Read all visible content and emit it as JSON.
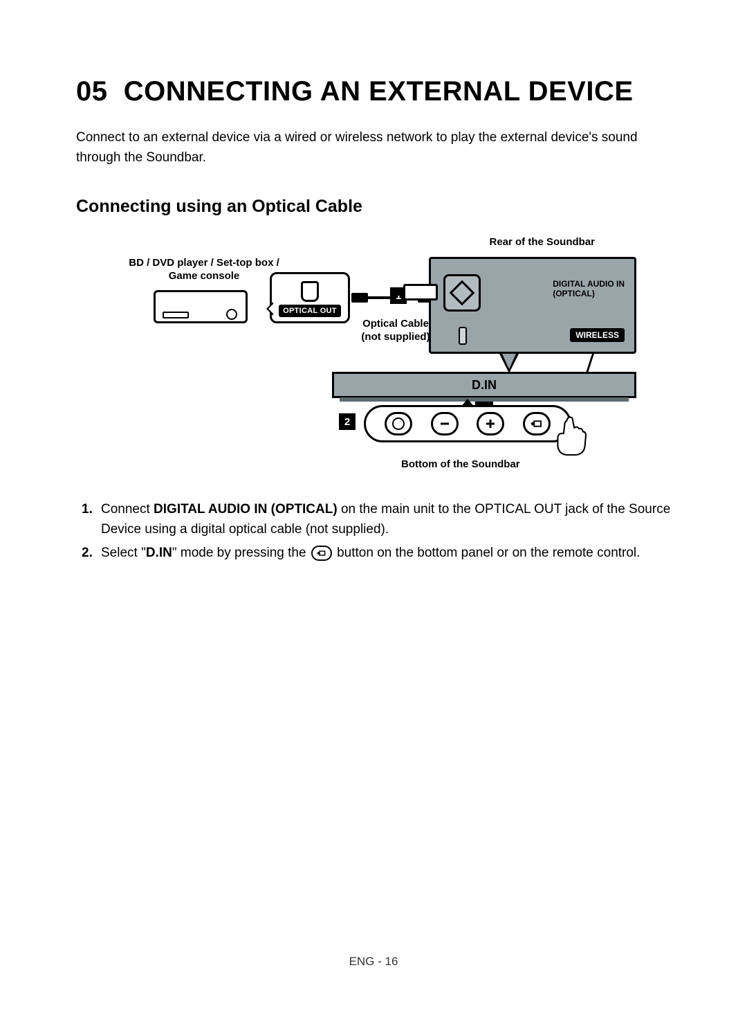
{
  "chapter": {
    "num": "05",
    "title": "CONNECTING AN EXTERNAL DEVICE"
  },
  "intro": "Connect to an external device via a wired or wireless network to play the external device's sound through the Soundbar.",
  "section": "Connecting using an Optical Cable",
  "diagram": {
    "rear_label": "Rear of the Soundbar",
    "source_label": "BD / DVD player / Set-top box / Game console",
    "optical_out": "OPTICAL OUT",
    "cable_label_1": "Optical Cable",
    "cable_label_2": "(not supplied)",
    "port_label_1": "DIGITAL AUDIO IN",
    "port_label_2": "(OPTICAL)",
    "wireless": "WIRELESS",
    "din": "D.IN",
    "bottom_label": "Bottom of the Soundbar",
    "marker1": "1",
    "marker2": "2"
  },
  "steps": {
    "s1_a": "Connect ",
    "s1_b": "DIGITAL AUDIO IN (OPTICAL)",
    "s1_c": " on the main unit to the OPTICAL OUT jack of the Source Device using a digital optical cable (not supplied).",
    "s2_a": "Select \"",
    "s2_b": "D.IN",
    "s2_c": "\" mode by pressing the ",
    "s2_d": " button on the bottom panel or on the remote control."
  },
  "footer": "ENG - 16"
}
